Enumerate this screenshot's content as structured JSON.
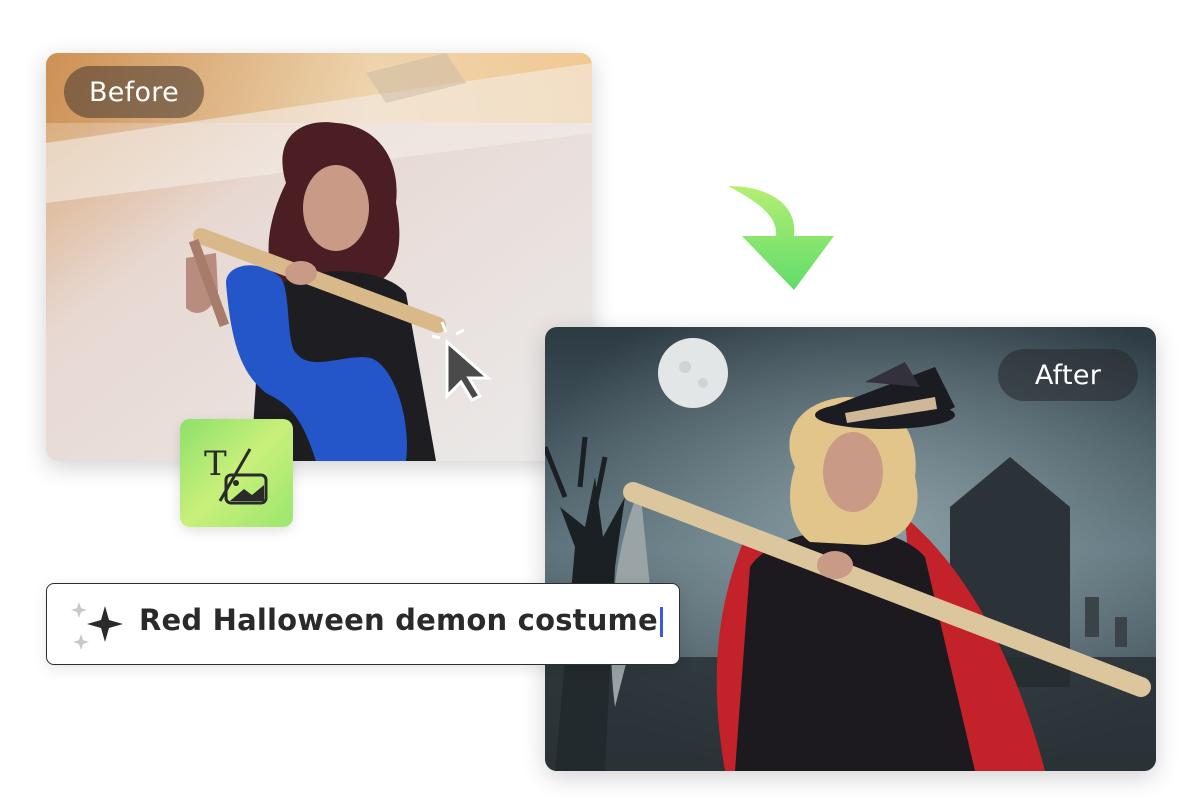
{
  "before": {
    "label": "Before"
  },
  "after": {
    "label": "After"
  },
  "prompt": {
    "text": "Red Halloween demon costume"
  },
  "tool": {
    "icon": "text-to-image-icon"
  },
  "colors": {
    "accent_green": "#6bdc5f",
    "mask_blue": "#2456c9",
    "caret_blue": "#3a57e8",
    "cape_red": "#c4222a"
  }
}
